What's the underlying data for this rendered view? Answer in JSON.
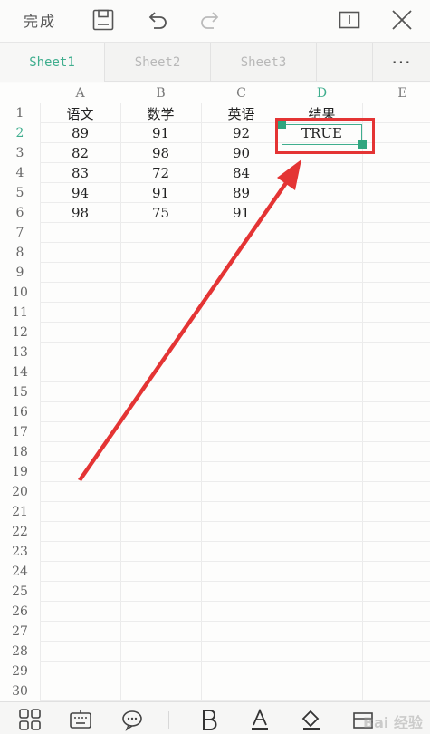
{
  "toolbar": {
    "done_label": "完成",
    "icons": [
      "save-icon",
      "undo-icon",
      "redo-icon",
      "fullscreen-icon",
      "close-icon"
    ]
  },
  "sheets": {
    "tabs": [
      "Sheet1",
      "Sheet2",
      "Sheet3"
    ],
    "active": "Sheet1",
    "more_label": "···"
  },
  "grid": {
    "columns": [
      "A",
      "B",
      "C",
      "D",
      "E"
    ],
    "rows": [
      "1",
      "2",
      "3",
      "4",
      "5",
      "6",
      "7",
      "8",
      "9",
      "10",
      "11",
      "12",
      "13",
      "14",
      "15",
      "16",
      "17",
      "18",
      "19",
      "20",
      "21",
      "22",
      "23",
      "24",
      "25",
      "26",
      "27",
      "28",
      "29",
      "30"
    ],
    "selected_column": "D",
    "selected_row": "2",
    "cells": {
      "A1": "语文",
      "B1": "数学",
      "C1": "英语",
      "D1": "结果",
      "A2": "89",
      "B2": "91",
      "C2": "92",
      "D2": "TRUE",
      "A3": "82",
      "B3": "98",
      "C3": "90",
      "A4": "83",
      "B4": "72",
      "C4": "84",
      "A5": "94",
      "B5": "91",
      "C5": "89",
      "A6": "98",
      "B6": "75",
      "C6": "91"
    }
  },
  "annotation": {
    "highlight_color": "#e43434",
    "arrow_color": "#e43434"
  },
  "colors": {
    "accent": "#3fae8e"
  },
  "bottombar": {
    "icons": [
      "apps-icon",
      "keyboard-icon",
      "comment-icon",
      "bold-icon",
      "font-color-icon",
      "fill-icon",
      "border-icon"
    ]
  },
  "watermark": "Bai 经验"
}
